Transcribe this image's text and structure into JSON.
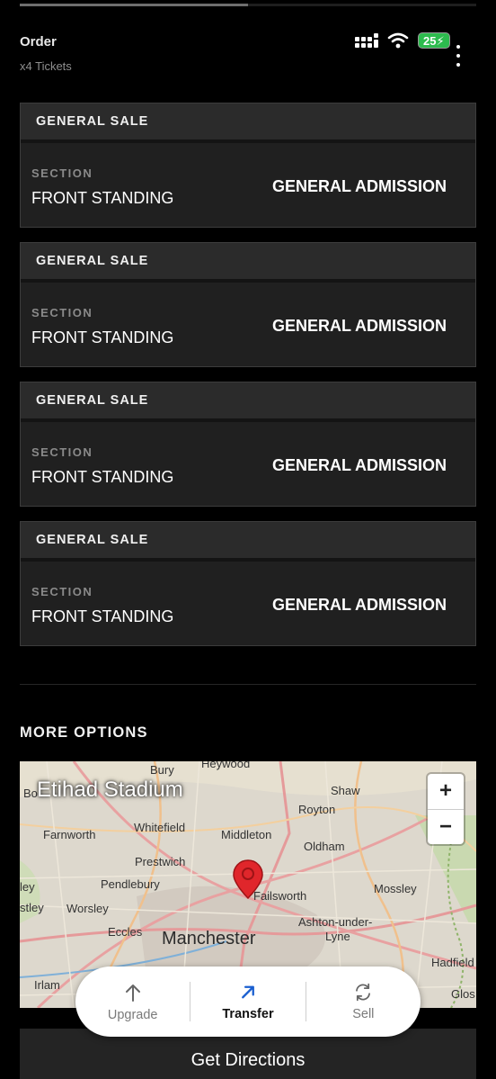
{
  "header": {
    "title": "Order",
    "subtitle": "x4 Tickets",
    "battery": "25"
  },
  "tickets": [
    {
      "sale": "GENERAL SALE",
      "section_label": "SECTION",
      "section": "FRONT STANDING",
      "admission": "GENERAL ADMISSION"
    },
    {
      "sale": "GENERAL SALE",
      "section_label": "SECTION",
      "section": "FRONT STANDING",
      "admission": "GENERAL ADMISSION"
    },
    {
      "sale": "GENERAL SALE",
      "section_label": "SECTION",
      "section": "FRONT STANDING",
      "admission": "GENERAL ADMISSION"
    },
    {
      "sale": "GENERAL SALE",
      "section_label": "SECTION",
      "section": "FRONT STANDING",
      "admission": "GENERAL ADMISSION"
    }
  ],
  "more_options": {
    "title": "MORE OPTIONS"
  },
  "map": {
    "venue": "Etihad Stadium",
    "zoom_in": "+",
    "zoom_out": "−",
    "towns": [
      "Bury",
      "Heywood",
      "Shaw",
      "Royton",
      "Whitefield",
      "Farnworth",
      "Middleton",
      "Oldham",
      "Prestwich",
      "Pendlebury",
      "Failsworth",
      "Mossley",
      "Worsley",
      "Eccles",
      "Manchester",
      "Ashton-under-",
      "Lyne",
      "Hadfield",
      "Irlam",
      "Glos",
      "Bo",
      "ley",
      "stley"
    ]
  },
  "actions": [
    {
      "label": "Upgrade",
      "icon": "arrow-up-icon"
    },
    {
      "label": "Transfer",
      "icon": "arrow-up-right-icon"
    },
    {
      "label": "Sell",
      "icon": "refresh-icon"
    }
  ],
  "directions": {
    "label": "Get Directions"
  },
  "colors": {
    "background": "#000000",
    "card": "#202020",
    "card_header": "#2b2b2b",
    "battery": "#2dbb4e",
    "transfer_icon": "#1a5fd0",
    "map_pin": "#e0262b"
  }
}
